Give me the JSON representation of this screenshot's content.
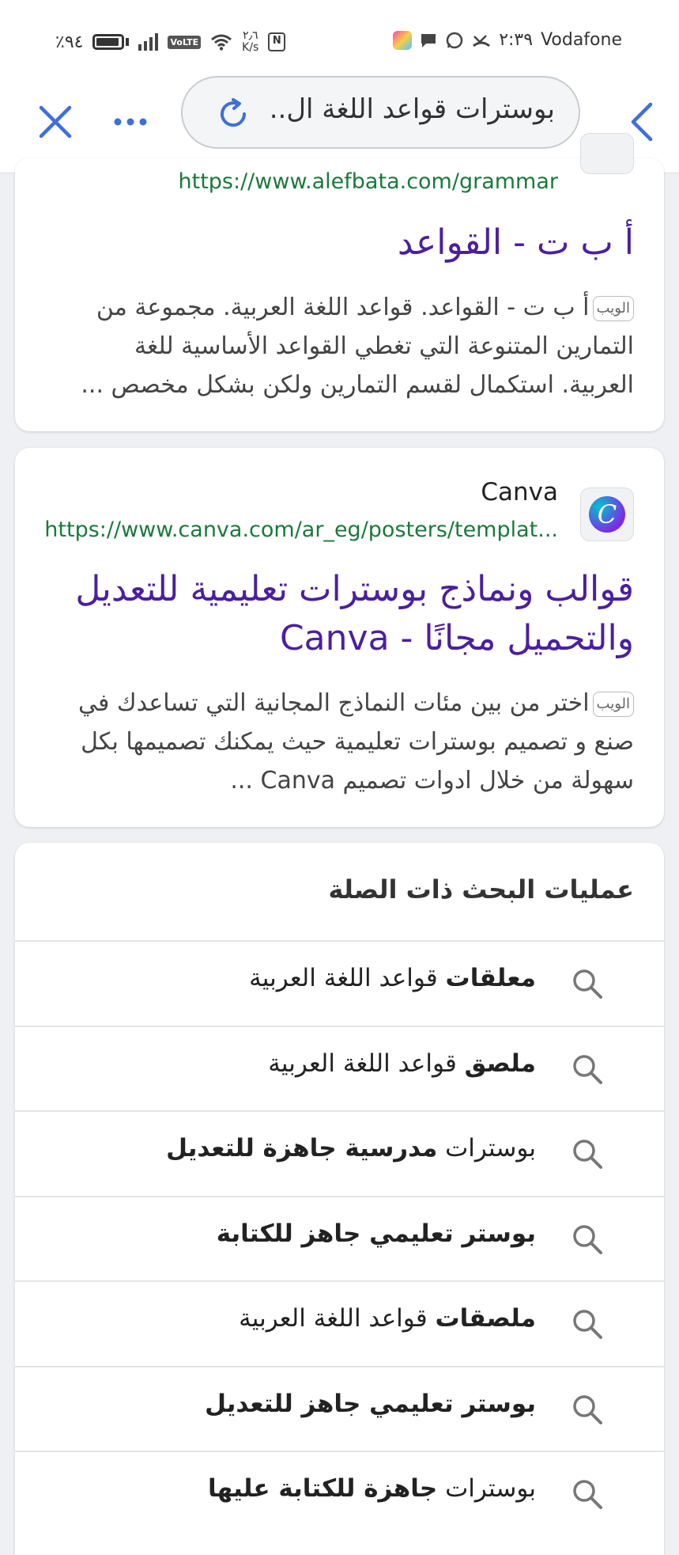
{
  "status_bar": {
    "battery": "٪٩٤",
    "speed_value": "٢٫٦",
    "speed_unit": "K/s",
    "volte": "VoLTE",
    "nfc": "N",
    "time": "٢:٣٩",
    "carrier": "Vodafone"
  },
  "address_bar": {
    "query": "بوسترات قواعد اللغة ال..",
    "more": "···",
    "close": "✕"
  },
  "result1": {
    "url": "https://www.alefbata.com/grammar",
    "title": "أ ب ت - القواعد",
    "badge": "الويب",
    "snippet": "أ ب ت - القواعد. قواعد اللغة العربية. مجموعة من التمارين المتنوعة التي تغطي القواعد الأساسية للغة العربية. استكمال لقسم التمارين ولكن بشكل مخصص ..."
  },
  "result2": {
    "site": "Canva",
    "url": "https://www.canva.com/ar_eg/posters/templat...",
    "title": "قوالب ونماذج بوسترات تعليمية للتعديل والتحميل مجانًا - Canva",
    "badge": "الويب",
    "snippet": "اختر من بين مئات النماذج المجانية التي تساعدك في صنع و تصميم بوسترات تعليمية حيث يمكنك تصميمها بكل سهولة من خلال ادوات تصميم Canva ...",
    "logo_letter": "C"
  },
  "related": {
    "heading": "عمليات البحث ذات الصلة",
    "items": [
      {
        "bold": "معلقات",
        "rest": " قواعد اللغة العربية",
        "bold_first": true
      },
      {
        "bold": "ملصق",
        "rest": " قواعد اللغة العربية",
        "bold_first": true
      },
      {
        "plain": "بوسترات ",
        "bold": "مدرسية جاهزة للتعديل",
        "bold_first": false
      },
      {
        "bold": "بوستر تعليمي جاهز للكتابة",
        "rest": "",
        "bold_first": true
      },
      {
        "bold": "ملصقات",
        "rest": " قواعد اللغة العربية",
        "bold_first": true
      },
      {
        "bold": "بوستر تعليمي جاهز للتعديل",
        "rest": "",
        "bold_first": true
      },
      {
        "plain": "بوسترات ",
        "bold": "جاهزة للكتابة عليها",
        "bold_first": false
      }
    ]
  },
  "colors": {
    "accent": "#3f6fd8",
    "link_title": "#4b1fa0",
    "url_green": "#1a7a3a"
  }
}
